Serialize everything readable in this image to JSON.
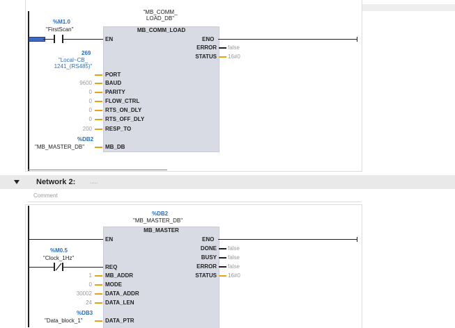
{
  "network1": {
    "instance_db": "\"MB_COMM_\nLOAD_DB\"",
    "block_name": "MB_COMM_LOAD",
    "en_label": "EN",
    "eno_label": "ENO",
    "contact_addr": "%M1.0",
    "contact_name": "\"FirstScan\"",
    "outputs": [
      {
        "pin": "ERROR",
        "value": "false"
      },
      {
        "pin": "STATUS",
        "value": "16#0"
      }
    ],
    "port_num": "269",
    "port_name": "\"Local~CB_\n1241_(RS485)\"",
    "inputs": [
      {
        "pin": "PORT",
        "value": ""
      },
      {
        "pin": "BAUD",
        "value": "9600"
      },
      {
        "pin": "PARITY",
        "value": "0"
      },
      {
        "pin": "FLOW_CTRL",
        "value": "0"
      },
      {
        "pin": "RTS_ON_DLY",
        "value": "0"
      },
      {
        "pin": "RTS_OFF_DLY",
        "value": "0"
      },
      {
        "pin": "RESP_TO",
        "value": "200"
      }
    ],
    "mb_db_addr": "%DB2",
    "mb_db_name": "\"MB_MASTER_DB\"",
    "mb_db_pin": "MB_DB"
  },
  "network2": {
    "header": "Network 2:",
    "title_placeholder": ".....",
    "comment": "Comment",
    "instance_addr": "%DB2",
    "instance_db": "\"MB_MASTER_DB\"",
    "block_name": "MB_MASTER",
    "en_label": "EN",
    "eno_label": "ENO",
    "contact_addr": "%M0.5",
    "contact_name": "\"Clock_1Hz\"",
    "outputs": [
      {
        "pin": "DONE",
        "value": "false"
      },
      {
        "pin": "BUSY",
        "value": "false"
      },
      {
        "pin": "ERROR",
        "value": "false"
      },
      {
        "pin": "STATUS",
        "value": "16#0"
      }
    ],
    "inputs": [
      {
        "pin": "REQ",
        "value": ""
      },
      {
        "pin": "MB_ADDR",
        "value": "1"
      },
      {
        "pin": "MODE",
        "value": "0"
      },
      {
        "pin": "DATA_ADDR",
        "value": "30002"
      },
      {
        "pin": "DATA_LEN",
        "value": "24"
      }
    ],
    "data_ptr_addr": "%DB3",
    "data_ptr_name": "\"Data_block_1\"",
    "data_ptr_pin": "DATA_PTR"
  }
}
